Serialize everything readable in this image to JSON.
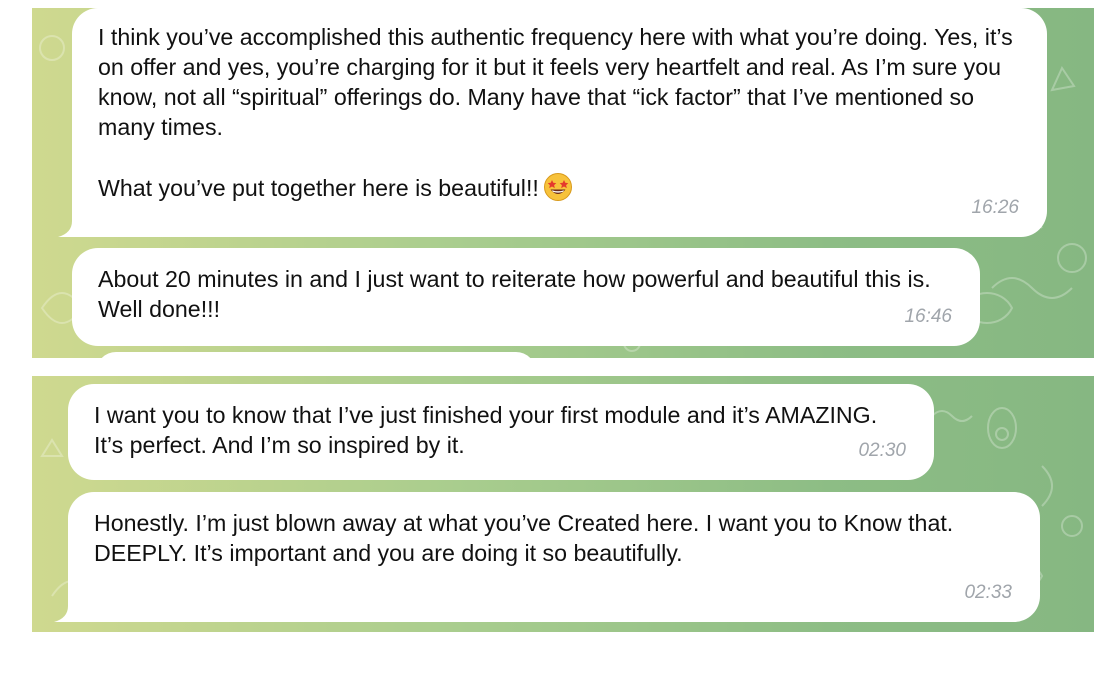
{
  "messages_top": [
    {
      "text": "I think you’ve accomplished this authentic frequency here with what you’re doing. Yes, it’s on offer and yes, you’re charging for it but it feels very heartfelt and real. As I’m sure you know, not all “spiritual” offerings do. Many have that “ick factor” that I’ve mentioned so many times.\n\nWhat you’ve put together here is beautiful!!",
      "emoji": "star-struck-emoji",
      "time": "16:26"
    },
    {
      "text": "About 20 minutes in and I just want to reiterate how powerful and beautiful this is. Well done!!!",
      "time": "16:46"
    }
  ],
  "messages_bottom": [
    {
      "text": "I want you to know that I’ve just finished your first module and it’s AMAZING. It’s perfect. And I’m so inspired by it.",
      "time": "02:30"
    },
    {
      "text": "Honestly. I’m just blown away at what you’ve Created here. I want you to Know that. DEEPLY. It’s important and you are doing it so beautifully.",
      "time": "02:33"
    }
  ],
  "colors": {
    "bubble": "#ffffff",
    "timestamp": "#a0a5ab",
    "wallpaper_left": "#cfd98f",
    "wallpaper_right": "#86b782"
  }
}
